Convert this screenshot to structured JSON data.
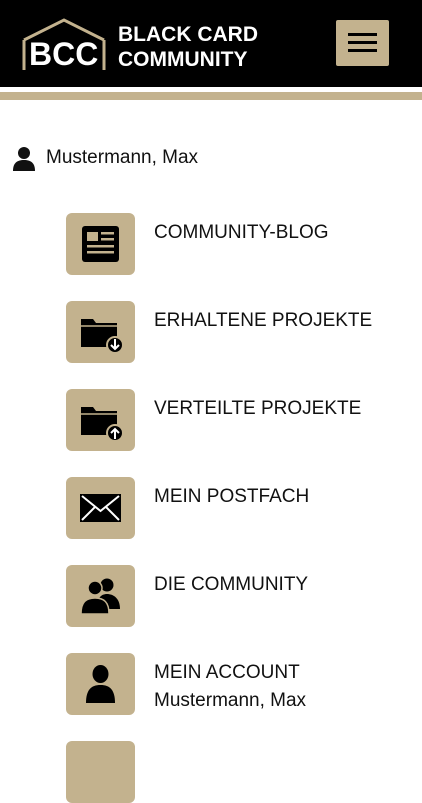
{
  "header": {
    "logo_text": "BCC",
    "brand_line1": "BLACK CARD",
    "brand_line2": "COMMUNITY",
    "menu_icon": "hamburger-menu-icon"
  },
  "user": {
    "icon": "person-icon",
    "name": "Mustermann, Max"
  },
  "menu": {
    "items": [
      {
        "label": "COMMUNITY-BLOG",
        "icon": "newspaper-icon"
      },
      {
        "label": "ERHALTENE PROJEKTE",
        "icon": "folder-download-icon"
      },
      {
        "label": "VERTEILTE PROJEKTE",
        "icon": "folder-upload-icon"
      },
      {
        "label": "MEIN POSTFACH",
        "icon": "envelope-icon"
      },
      {
        "label": "DIE COMMUNITY",
        "icon": "users-icon"
      },
      {
        "label": "MEIN ACCOUNT",
        "sublabel": "Mustermann, Max",
        "icon": "account-icon"
      }
    ]
  },
  "colors": {
    "accent": "#c3b28e",
    "header_bg": "#000000",
    "background": "#ffffff"
  }
}
